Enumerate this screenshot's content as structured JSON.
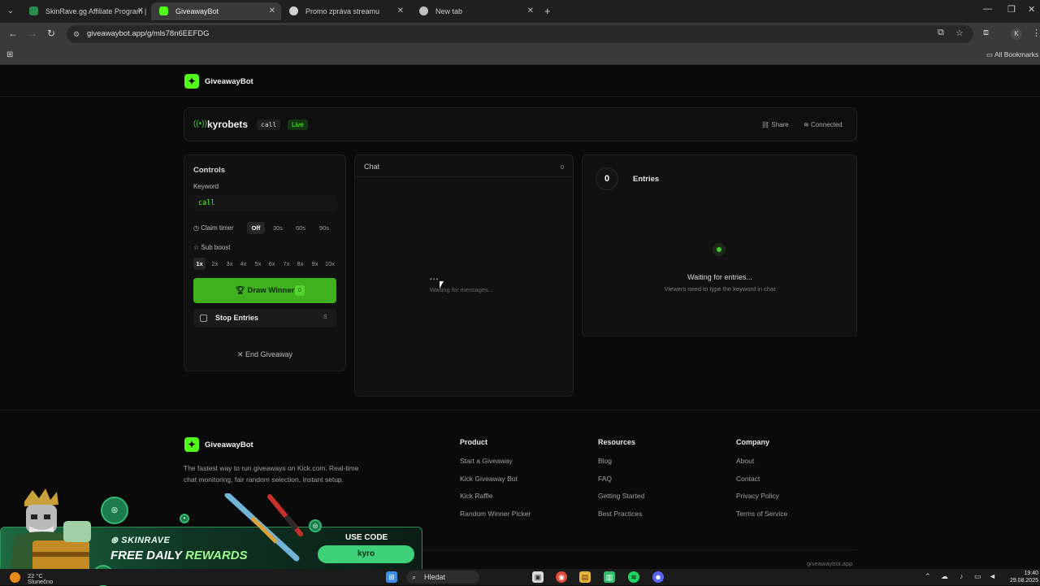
{
  "browser": {
    "tabs": [
      {
        "title": "SkinRave.gg Affiliate Program |",
        "favicon_color": "#2a8a4f"
      },
      {
        "title": "GiveawayBot",
        "favicon_color": "#53fc18"
      },
      {
        "title": "Promo zpráva streamu",
        "favicon_color": "#d0d0d0"
      },
      {
        "title": "New tab",
        "favicon_color": "#c0c0c0"
      }
    ],
    "url": "giveawaybot.app/g/mls78n6EEFDG",
    "bookmarks_label": "All Bookmarks",
    "profile_initial": "K"
  },
  "header": {
    "brand": "GiveawayBot"
  },
  "stream": {
    "channel": "kyrobets",
    "keyword": "call",
    "status": "Live",
    "share_label": "Share",
    "connection": "Connected"
  },
  "controls": {
    "title": "Controls",
    "keyword_label": "Keyword",
    "keyword_value": "call",
    "claim_timer_label": "Claim timer",
    "claim_timer_options": [
      "Off",
      "30s",
      "60s",
      "90s"
    ],
    "claim_timer_selected": "Off",
    "sub_boost_label": "Sub boost",
    "sub_boost_options": [
      "1x",
      "2x",
      "3x",
      "4x",
      "5x",
      "6x",
      "7x",
      "8x",
      "9x",
      "10x"
    ],
    "sub_boost_selected": "1x",
    "draw_label": "Draw Winner",
    "draw_count": "0",
    "stop_label": "Stop Entries",
    "stop_shortcut": "S",
    "end_label": "End Giveaway"
  },
  "chat": {
    "title": "Chat",
    "count": "0",
    "empty": "Waiting for messages..."
  },
  "entries": {
    "count": "0",
    "label": "Entries",
    "waiting_title": "Waiting for entries...",
    "waiting_sub": "Viewers need to type the keyword in chat"
  },
  "footer": {
    "brand": "GiveawayBot",
    "description": "The fastest way to run giveaways on Kick.com. Real-time chat monitoring, fair random selection, instant setup.",
    "columns": [
      {
        "heading": "Product",
        "links": [
          "Start a Giveaway",
          "Kick Giveaway Bot",
          "Kick Raffle",
          "Random Winner Picker"
        ]
      },
      {
        "heading": "Resources",
        "links": [
          "Blog",
          "FAQ",
          "Getting Started",
          "Best Practices"
        ]
      },
      {
        "heading": "Company",
        "links": [
          "About",
          "Contact",
          "Privacy Policy",
          "Terms of Service"
        ]
      }
    ],
    "domain": "giveawaybot.app"
  },
  "promo": {
    "brand": "SKINRAVE",
    "headline_a": "FREE DAILY",
    "headline_b": "REWARDS",
    "use_code_label": "USE CODE",
    "code": "kyro"
  },
  "taskbar": {
    "weather_temp": "22 °C",
    "weather_desc": "Slunečno",
    "search_label": "Hledat",
    "time": "19:40",
    "date": "29.08.2025"
  }
}
